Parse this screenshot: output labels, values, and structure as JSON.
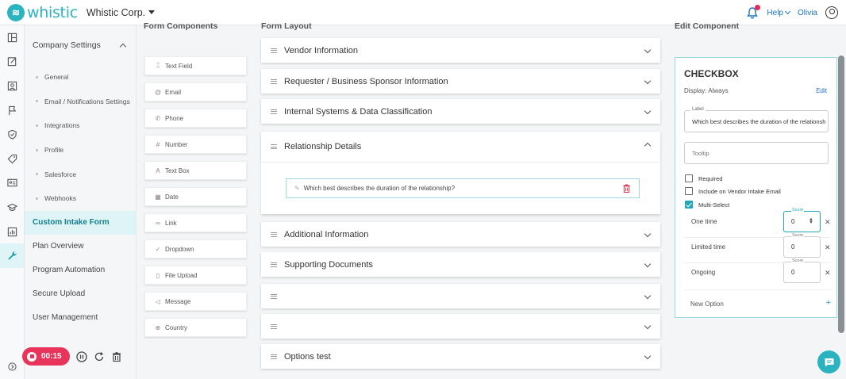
{
  "header": {
    "logo_text": "whistic",
    "company": "Whistic Corp.",
    "help": "Help",
    "user": "Olivia"
  },
  "sidebar": {
    "group_title": "Company Settings",
    "sub_items": [
      "General",
      "Email / Notifications Settings",
      "Integrations",
      "Profile",
      "Salesforce",
      "Webhooks"
    ],
    "items": [
      "Custom Intake Form",
      "Plan Overview",
      "Program Automation",
      "Secure Upload",
      "User Management"
    ],
    "active": "Custom Intake Form"
  },
  "columns": {
    "components": "Form Components",
    "layout": "Form Layout",
    "edit": "Edit Component"
  },
  "components": [
    {
      "label": "Text Field",
      "icon": "text-icon"
    },
    {
      "label": "Email",
      "icon": "at-icon"
    },
    {
      "label": "Phone",
      "icon": "phone-icon"
    },
    {
      "label": "Number",
      "icon": "hash-icon"
    },
    {
      "label": "Text Box",
      "icon": "text-box-icon"
    },
    {
      "label": "Date",
      "icon": "calendar-icon"
    },
    {
      "label": "Link",
      "icon": "link-icon"
    },
    {
      "label": "Dropdown",
      "icon": "check-icon"
    },
    {
      "label": "File Upload",
      "icon": "file-icon"
    },
    {
      "label": "Message",
      "icon": "message-icon"
    },
    {
      "label": "Country",
      "icon": "globe-icon"
    }
  ],
  "sections": [
    {
      "title": "Vendor Information"
    },
    {
      "title": "Requester / Business Sponsor Information"
    },
    {
      "title": "Internal Systems & Data Classification"
    },
    {
      "title": "Relationship Details",
      "expanded": true
    },
    {
      "title": "Additional Information"
    },
    {
      "title": "Supporting Documents"
    },
    {
      "title": ""
    },
    {
      "title": ""
    },
    {
      "title": "Options test"
    }
  ],
  "expanded_question": "Which best describes the duration of the relationship?",
  "edit_component": {
    "type": "CHECKBOX",
    "display": "Display: Always",
    "edit_link": "Edit",
    "label_caption": "Label",
    "label_value": "Which best describes the duration of the relationship?",
    "tooltip_placeholder": "Tooltip",
    "checkboxes": [
      {
        "label": "Required",
        "checked": false
      },
      {
        "label": "Include on Vendor Intake Email",
        "checked": false
      },
      {
        "label": "Multi-Select",
        "checked": true
      }
    ],
    "score_caption": "Score",
    "options": [
      {
        "label": "One time",
        "score": "0"
      },
      {
        "label": "Limited time",
        "score": "0"
      },
      {
        "label": "Ongoing",
        "score": "0"
      }
    ],
    "new_option": "New Option"
  },
  "recorder": {
    "time": "00:15"
  },
  "colors": {
    "brand": "#2bb3c0",
    "record": "#e8335a",
    "active_bg": "#dff4f7",
    "link": "#1a73c9"
  }
}
